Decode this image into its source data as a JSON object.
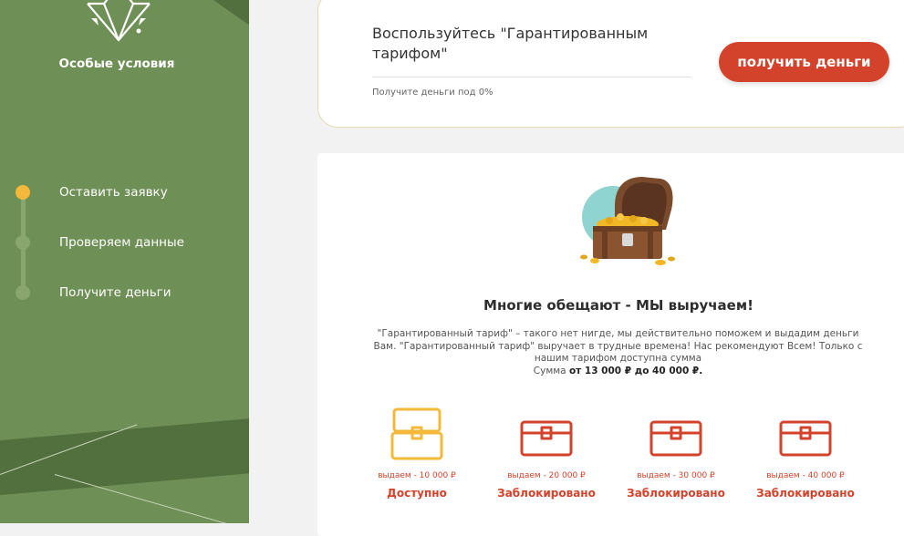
{
  "sidebar": {
    "brand_label": "Особые условия",
    "steps": [
      {
        "label": "Оставить заявку",
        "active": true
      },
      {
        "label": "Проверяем данные",
        "active": false
      },
      {
        "label": "Получите деньги",
        "active": false
      }
    ]
  },
  "promo": {
    "title": "Воспользуйтесь \"Гарантированным тарифом\"",
    "subtitle": "Получите деньги под 0%",
    "button_label": "получить деньги"
  },
  "main": {
    "heading": "Многие обещают - МЫ выручаем!",
    "description": "\"Гарантированный тариф\" – такого нет нигде, мы действительно поможем и выдадим деньги Вам. \"Гарантированный тариф\" выручает в трудные времена! Нас рекомендуют Всем! Только с нашим тарифом доступна сумма",
    "sum_prefix": "Сумма",
    "sum_range": "от 13 000 ₽ до 40 000 ₽.",
    "tiers": [
      {
        "amount": "выдаем - 10 000 ₽",
        "status": "Доступно",
        "available": true
      },
      {
        "amount": "выдаем - 20 000 ₽",
        "status": "Заблокировано",
        "available": false
      },
      {
        "amount": "выдаем - 30 000 ₽",
        "status": "Заблокировано",
        "available": false
      },
      {
        "amount": "выдаем - 40 000 ₽",
        "status": "Заблокировано",
        "available": false
      }
    ]
  },
  "colors": {
    "sidebar_green": "#6e8f55",
    "accent_red": "#d3432b",
    "accent_gold": "#f4b93a"
  }
}
